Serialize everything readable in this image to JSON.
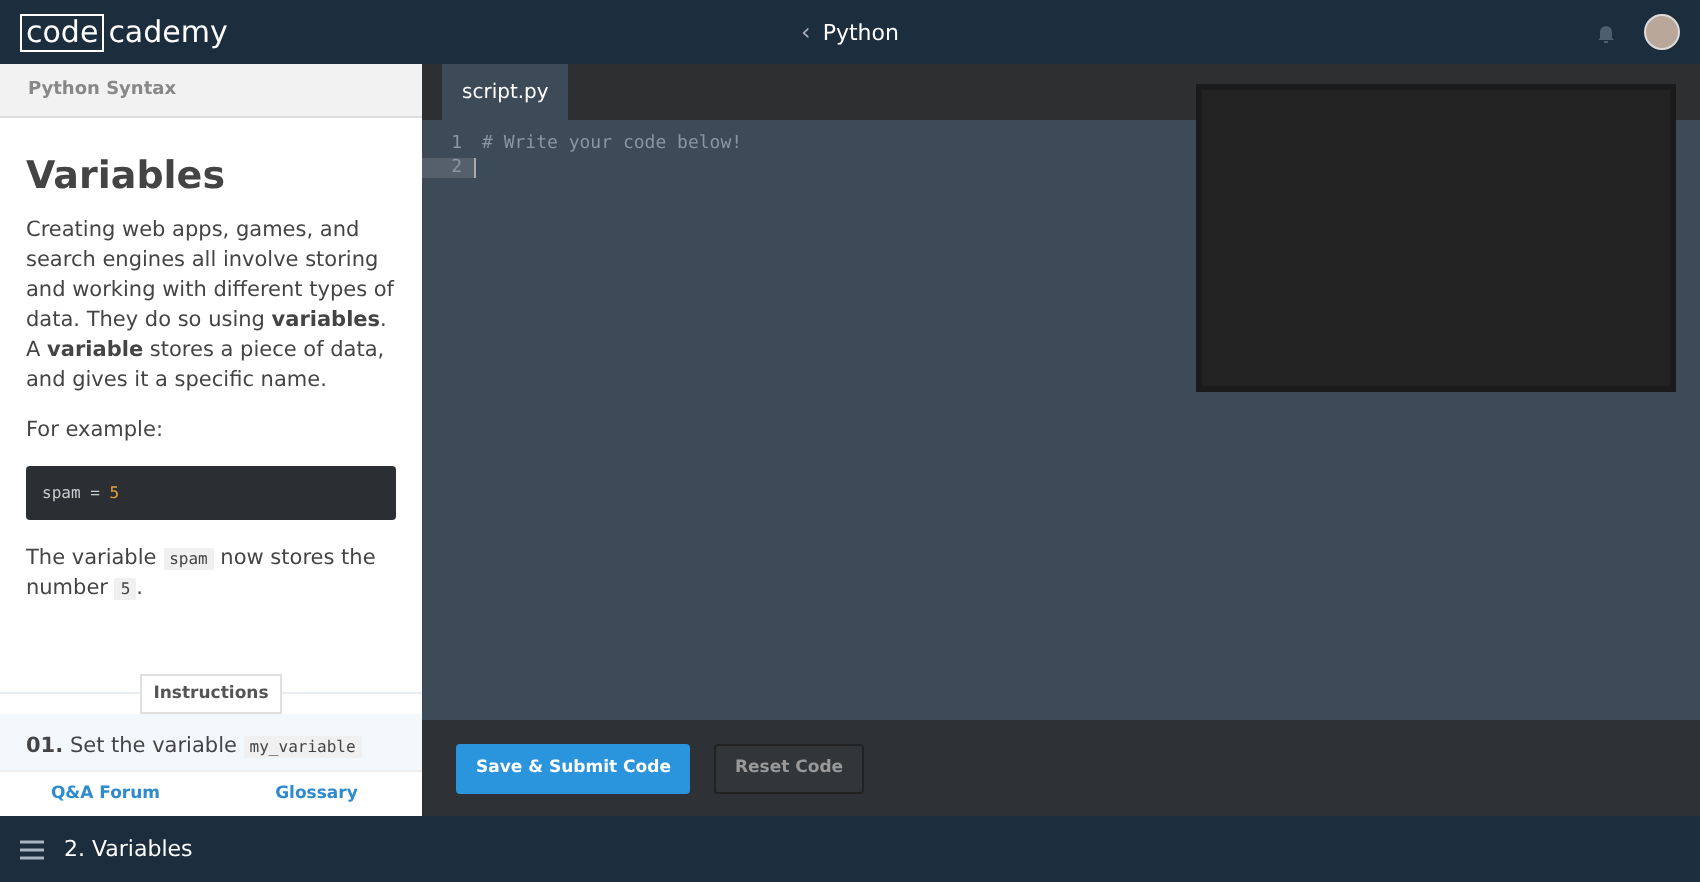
{
  "header": {
    "logo_boxed": "code",
    "logo_rest": "cademy",
    "course": "Python",
    "back_glyph": "‹"
  },
  "lesson": {
    "section": "Python Syntax",
    "title": "Variables",
    "paragraphs": [
      [
        {
          "kind": "text",
          "text": "Creating web apps, games, and search engines all involve storing and working with different types of data. They do so using **variables**. A **variable** stores a piece of data, and gives it a specific name."
        }
      ],
      [
        {
          "kind": "text",
          "text": "For example:"
        }
      ]
    ],
    "code_example": [
      {
        "kind": "name",
        "text": "spam"
      },
      {
        "kind": "op",
        "text": " = "
      },
      {
        "kind": "number",
        "text": "5"
      }
    ],
    "after": [
      {
        "kind": "text",
        "text": "The variable "
      },
      {
        "kind": "code",
        "text": "spam"
      },
      {
        "kind": "text",
        "text": " now stores the number "
      },
      {
        "kind": "code",
        "text": "5"
      },
      {
        "kind": "text",
        "text": "."
      }
    ],
    "instructions_label": "Instructions",
    "instruction": {
      "number": "01.",
      "parts": [
        {
          "kind": "text",
          "text": " Set the variable "
        },
        {
          "kind": "code",
          "text": "my_variable"
        }
      ]
    },
    "links": [
      "Q&A Forum",
      "Glossary"
    ]
  },
  "editor": {
    "tabs": [
      {
        "label": "script.py",
        "selected": true
      }
    ],
    "lines": [
      {
        "number": "1",
        "text": "# Write your code below!",
        "active": false
      },
      {
        "number": "2",
        "active": true
      }
    ]
  },
  "buttons": [
    {
      "label": "Save & Submit Code",
      "kind": "primary"
    },
    {
      "label": "Reset Code",
      "kind": "secondary"
    }
  ],
  "footer": {
    "lesson": "2. Variables"
  }
}
